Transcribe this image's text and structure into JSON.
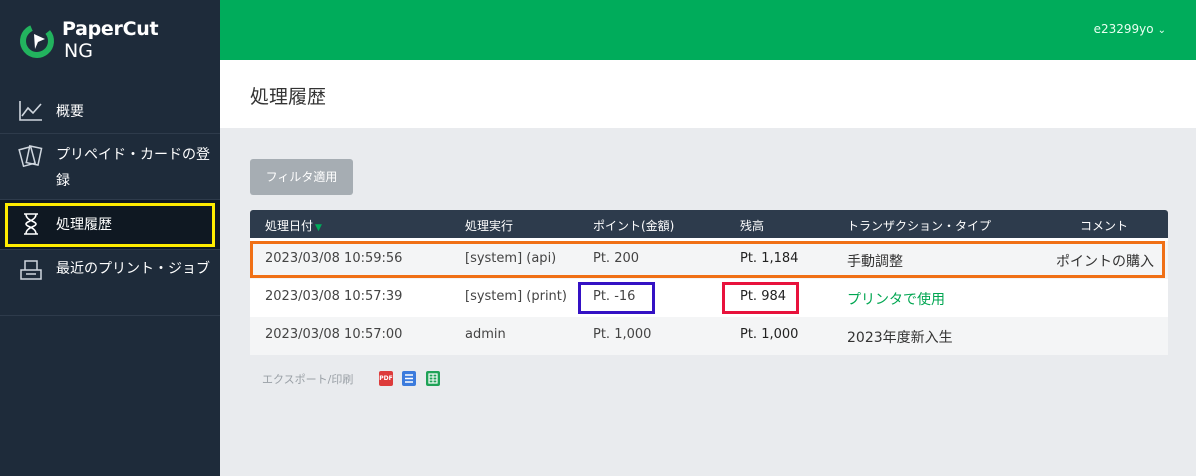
{
  "brand": {
    "name": "PaperCut",
    "sub": "NG",
    "colors": {
      "sidebar": "#1e2b3a",
      "accent": "#00ac5b",
      "header_bg": "#2d3b4c"
    }
  },
  "sidebar": {
    "items": [
      {
        "label": "概要",
        "icon": "chart-line-icon"
      },
      {
        "label": "プリペイド・カードの登録",
        "icon": "cards-icon"
      },
      {
        "label": "処理履歴",
        "icon": "hourglass-icon",
        "active": true
      },
      {
        "label": "最近のプリント・ジョブ",
        "icon": "printer-tray-icon"
      }
    ]
  },
  "topbar": {
    "username": "e23299yo"
  },
  "page": {
    "title": "処理履歴"
  },
  "filter": {
    "button_label": "フィルタ適用"
  },
  "table": {
    "columns": {
      "date": "処理日付",
      "actor": "処理実行",
      "amount": "ポイント(金額)",
      "balance": "残高",
      "type": "トランザクション・タイプ",
      "comment": "コメント"
    },
    "sort_indicator": "▼",
    "rows": [
      {
        "date": "2023/03/08 10:59:56",
        "actor": "[system] (api)",
        "amount": "Pt. 200",
        "balance": "Pt. 1,184",
        "type": "手動調整",
        "comment": "ポイントの購入"
      },
      {
        "date": "2023/03/08 10:57:39",
        "actor": "[system] (print)",
        "amount": "Pt. -16",
        "balance": "Pt. 984",
        "type": "プリンタで使用",
        "comment": ""
      },
      {
        "date": "2023/03/08 10:57:00",
        "actor": "admin",
        "amount": "Pt. 1,000",
        "balance": "Pt. 1,000",
        "type": "2023年度新入生",
        "comment": ""
      }
    ]
  },
  "export": {
    "label": "エクスポート/印刷",
    "icons": [
      "pdf-icon",
      "list-export-icon",
      "spreadsheet-icon"
    ],
    "pdf_text": "PDF"
  },
  "highlights": {
    "sidebar_active": "#ffec00",
    "row_box": "#f07016",
    "amount_box": "#3411c4",
    "balance_box": "#e8123c"
  }
}
